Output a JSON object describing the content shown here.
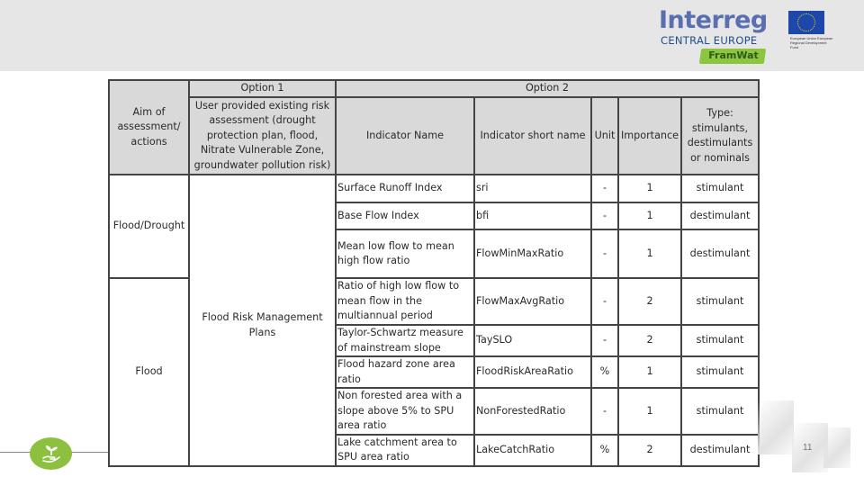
{
  "header": {
    "logo": {
      "brand": "Interreg",
      "subtitle": "CENTRAL EUROPE",
      "eu_text": "European Union European Regional Development Fund",
      "project": "FramWat"
    }
  },
  "table": {
    "header": {
      "aim": "Aim of assessment/ actions",
      "option1": "Option 1",
      "option1_desc": "User provided existing risk assessment (drought protection plan, flood, Nitrate Vulnerable Zone, groundwater pollution risk)",
      "option2": "Option 2",
      "indicator_name": "Indicator Name",
      "indicator_short": "Indicator short name",
      "unit": "Unit",
      "importance": "Importance",
      "type": "Type: stimulants, destimulants or nominals"
    },
    "groups": {
      "flood_drought": "Flood/Drought",
      "flood": "Flood",
      "frmp": "Flood Risk Management Plans"
    },
    "rows": [
      {
        "name": "Surface Runoff Index",
        "short": "sri",
        "unit": "-",
        "importance": "1",
        "type": "stimulant"
      },
      {
        "name": "Base Flow Index",
        "short": "bfi",
        "unit": "-",
        "importance": "1",
        "type": "destimulant"
      },
      {
        "name": "Mean low flow to mean high flow ratio",
        "short": "FlowMinMaxRatio",
        "unit": "-",
        "importance": "1",
        "type": "destimulant"
      },
      {
        "name": "Ratio of high low flow to mean flow in the multiannual period",
        "short": "FlowMaxAvgRatio",
        "unit": "-",
        "importance": "2",
        "type": "stimulant"
      },
      {
        "name": "Taylor-Schwartz measure of mainstream slope",
        "short": "TaySLO",
        "unit": "-",
        "importance": "2",
        "type": "stimulant"
      },
      {
        "name": "Flood hazard zone area ratio",
        "short": "FloodRiskAreaRatio",
        "unit": "%",
        "importance": "1",
        "type": "stimulant"
      },
      {
        "name": "Non forested area with a slope above 5% to SPU area ratio",
        "short": "NonForestedRatio",
        "unit": "-",
        "importance": "1",
        "type": "stimulant"
      },
      {
        "name": "Lake catchment area to SPU area ratio",
        "short": "LakeCatchRatio",
        "unit": "%",
        "importance": "2",
        "type": "destimulant"
      }
    ]
  },
  "footer": {
    "page_number": "11",
    "badge_icon": "plant-in-hand-icon"
  }
}
